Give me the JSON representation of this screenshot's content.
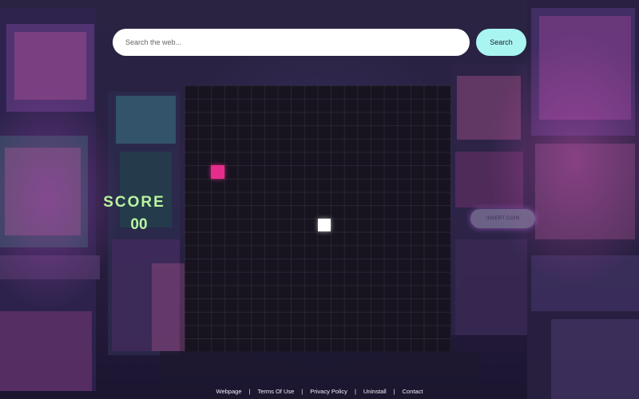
{
  "search": {
    "placeholder": "Search the web...",
    "button_label": "Search"
  },
  "game": {
    "score_label": "SCORE",
    "score_value": "00",
    "insert_coin_label": "INSERT COIN",
    "food_icon": "square-food-icon",
    "snake_icon": "square-snake-head-icon"
  },
  "footer": {
    "links": [
      "Webpage",
      "Terms Of Use",
      "Privacy Policy",
      "Uninstall",
      "Contact"
    ],
    "separator": "|"
  },
  "colors": {
    "search_button": "#a8f5f2",
    "score_text": "#b9f5a0",
    "food": "#e62d8c",
    "snake": "#ffffff",
    "board_bg": "#171420",
    "insert_coin_glow": "#d278ff"
  }
}
